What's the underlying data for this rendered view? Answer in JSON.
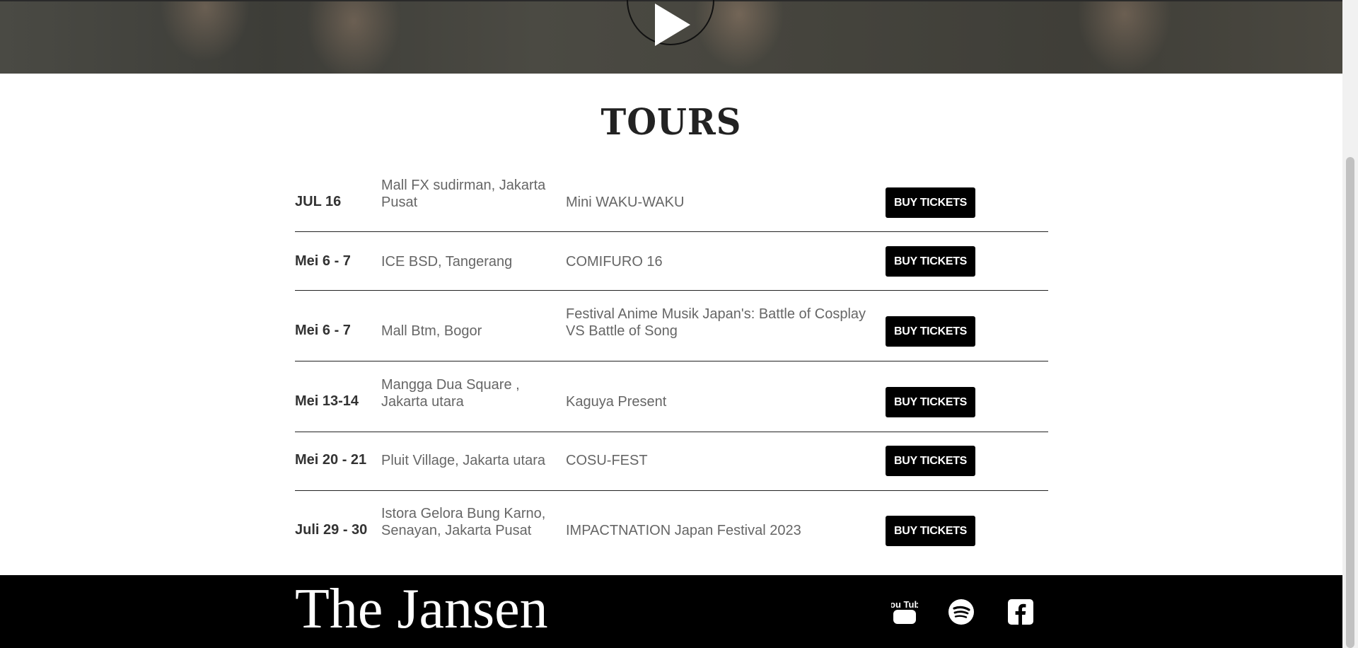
{
  "hero": {
    "play_icon": "play-icon"
  },
  "section": {
    "title": "TOURS"
  },
  "tours": [
    {
      "date": "JUL 16",
      "venue": "Mall FX sudirman, Jakarta Pusat",
      "event": "Mini WAKU-WAKU",
      "button": "BUY TICKETS"
    },
    {
      "date": "Mei 6 - 7",
      "venue": "ICE BSD, Tangerang",
      "event": "COMIFURO 16",
      "button": "BUY TICKETS"
    },
    {
      "date": "Mei 6 - 7",
      "venue": "Mall Btm, Bogor",
      "event": "Festival Anime Musik Japan's: Battle of Cosplay VS Battle of Song",
      "button": "BUY TICKETS"
    },
    {
      "date": "Mei 13-14",
      "venue": "Mangga Dua Square , Jakarta utara",
      "event": "Kaguya Present",
      "button": "BUY TICKETS"
    },
    {
      "date": "Mei 20 - 21",
      "venue": "Pluit Village, Jakarta utara",
      "event": "COSU-FEST",
      "button": "BUY TICKETS"
    },
    {
      "date": "Juli 29 - 30",
      "venue": "Istora Gelora Bung Karno, Senayan, Jakarta Pusat",
      "event": "IMPACTNATION Japan Festival 2023",
      "button": "BUY TICKETS"
    }
  ],
  "footer": {
    "brand": "The Jansen",
    "youtube_text": "You Tube",
    "icons": [
      "youtube-icon",
      "spotify-icon",
      "facebook-icon"
    ]
  }
}
